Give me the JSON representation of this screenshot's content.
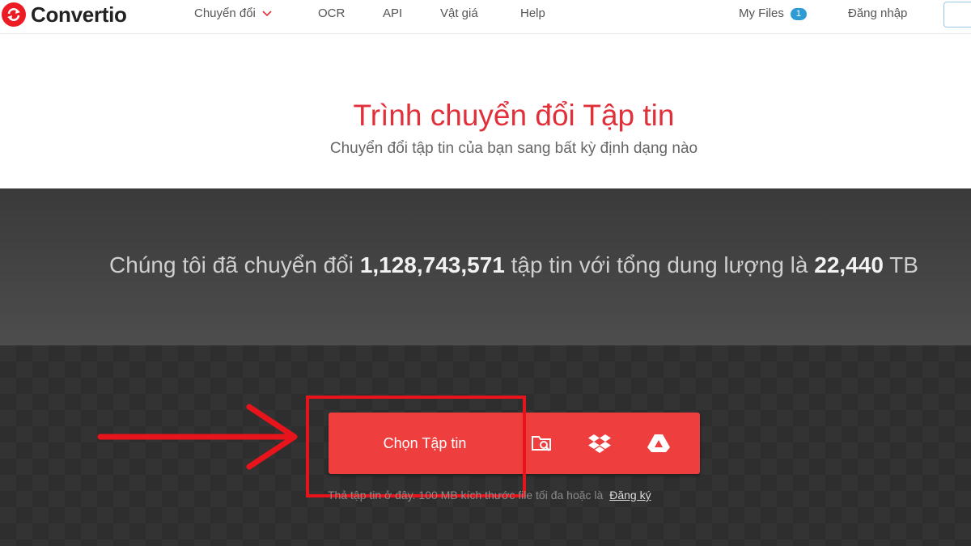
{
  "header": {
    "logo_text": "Convertio",
    "nav": [
      {
        "label": "Chuyển đổi"
      },
      {
        "label": "OCR"
      },
      {
        "label": "API"
      },
      {
        "label": "Vật giá"
      },
      {
        "label": "Help"
      }
    ],
    "my_files_label": "My Files",
    "my_files_count": "1",
    "login_label": "Đăng nhập"
  },
  "hero": {
    "title": "Trình chuyển đổi Tập tin",
    "subtitle": "Chuyển đổi tập tin của bạn sang bất kỳ định dạng nào"
  },
  "stats": {
    "prefix": "Chúng tôi đã chuyển đổi",
    "files_count": "1,128,743,571",
    "middle": "tập tin với tổng dung lượng là",
    "total_size": "22,440",
    "unit": "TB"
  },
  "upload": {
    "choose_label": "Chọn Tập tin",
    "hint_text": "Thả tập tin ở đây. 100 MB kích thước file tối đa hoặc là",
    "signup_link": "Đăng ký"
  },
  "colors": {
    "brand_red": "#ee3e3e",
    "annotation_red": "#e8141c",
    "badge_blue": "#2e9bd6"
  },
  "icons": [
    "refresh-logo-icon",
    "chevron-down-icon",
    "folder-search-icon",
    "dropbox-icon",
    "google-drive-icon",
    "arrow-annotation-icon"
  ]
}
